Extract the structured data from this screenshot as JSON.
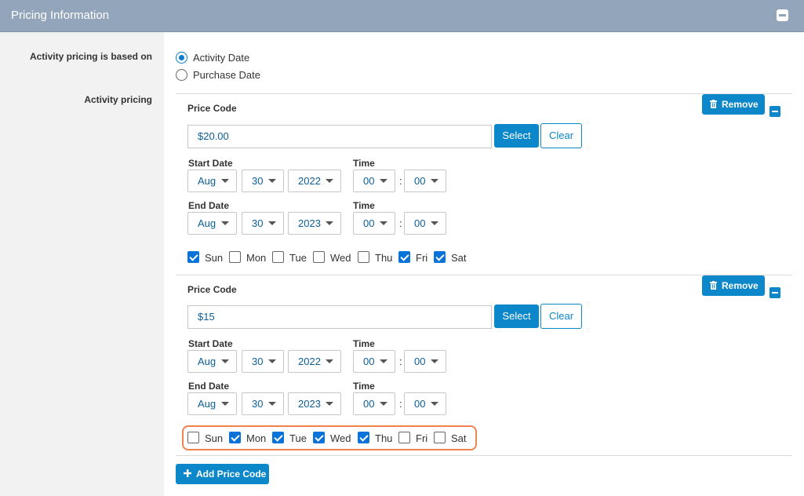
{
  "panel": {
    "title": "Pricing Information"
  },
  "pricing_basis": {
    "label": "Activity pricing is based on",
    "options": [
      {
        "label": "Activity Date",
        "selected": true
      },
      {
        "label": "Purchase Date",
        "selected": false
      }
    ]
  },
  "activity_pricing": {
    "label": "Activity pricing",
    "price_code_label": "Price Code",
    "remove_label": "Remove",
    "select_label": "Select",
    "clear_label": "Clear",
    "start_date_label": "Start Date",
    "end_date_label": "End Date",
    "time_label": "Time",
    "time_separator": ":",
    "add_price_code_label": "Add Price Code",
    "price_codes": [
      {
        "price_code": "$20.00",
        "start": {
          "month": "Aug",
          "day": "30",
          "year": "2022",
          "hour": "00",
          "minute": "00"
        },
        "end": {
          "month": "Aug",
          "day": "30",
          "year": "2023",
          "hour": "00",
          "minute": "00"
        },
        "days": [
          {
            "label": "Sun",
            "checked": true
          },
          {
            "label": "Mon",
            "checked": false
          },
          {
            "label": "Tue",
            "checked": false
          },
          {
            "label": "Wed",
            "checked": false
          },
          {
            "label": "Thu",
            "checked": false
          },
          {
            "label": "Fri",
            "checked": true
          },
          {
            "label": "Sat",
            "checked": true
          }
        ]
      },
      {
        "price_code": "$15",
        "start": {
          "month": "Aug",
          "day": "30",
          "year": "2022",
          "hour": "00",
          "minute": "00"
        },
        "end": {
          "month": "Aug",
          "day": "30",
          "year": "2023",
          "hour": "00",
          "minute": "00"
        },
        "days": [
          {
            "label": "Sun",
            "checked": false
          },
          {
            "label": "Mon",
            "checked": true
          },
          {
            "label": "Tue",
            "checked": true
          },
          {
            "label": "Wed",
            "checked": true
          },
          {
            "label": "Thu",
            "checked": true
          },
          {
            "label": "Fri",
            "checked": false
          },
          {
            "label": "Sat",
            "checked": false
          }
        ]
      }
    ]
  },
  "colors": {
    "header_bg": "#93a5bb",
    "primary": "#0c87c9",
    "highlight": "#f0834f",
    "checkbox": "#0a73d9"
  }
}
